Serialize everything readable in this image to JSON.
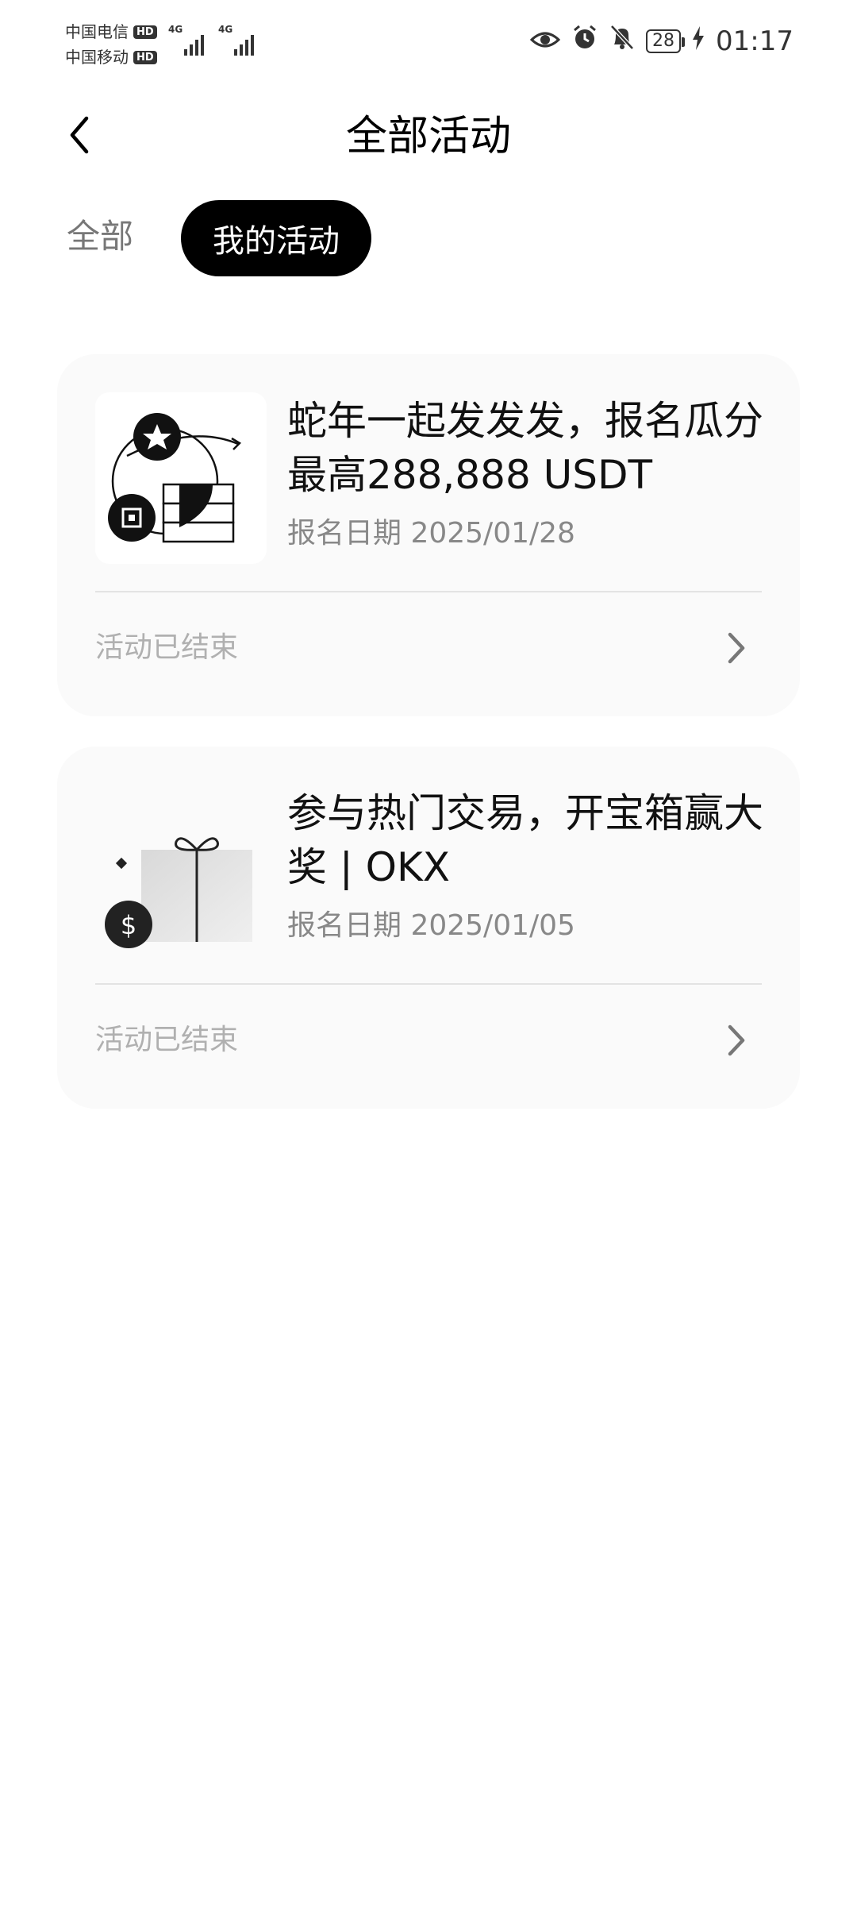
{
  "status_bar": {
    "carrier_1": "中国电信",
    "carrier_2": "中国移动",
    "hd_label": "HD",
    "network_1": "4G",
    "network_2": "4G",
    "battery": "28",
    "time": "01:17",
    "icons": [
      "eye-icon",
      "alarm-icon",
      "mute-bell-icon",
      "battery-icon",
      "charging-icon"
    ]
  },
  "header": {
    "title": "全部活动",
    "back_icon": "chevron-left-icon"
  },
  "tabs": [
    {
      "label": "全部",
      "active": false
    },
    {
      "label": "我的活动",
      "active": true
    }
  ],
  "activities": [
    {
      "title": "蛇年一起发发发，报名瓜分最高288,888 USDT",
      "date": "报名日期 2025/01/28",
      "status": "活动已结束",
      "thumbnail_icon": "star-coins-chart-icon"
    },
    {
      "title": "参与热门交易，开宝箱赢大奖 | OKX",
      "date": "报名日期 2025/01/05",
      "status": "活动已结束",
      "thumbnail_icon": "gift-box-coin-icon"
    }
  ],
  "colors": {
    "accent": "#000000",
    "card_bg": "#fafafa",
    "muted_text": "#888888",
    "ended_text": "#b0b0b0"
  }
}
